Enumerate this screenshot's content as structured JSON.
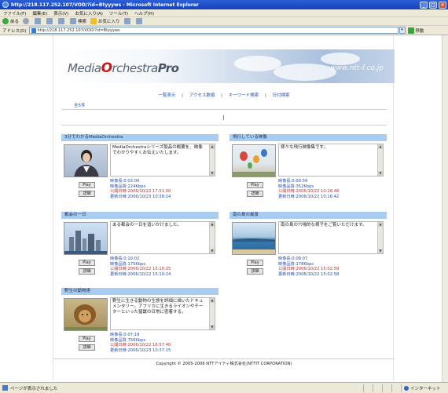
{
  "window": {
    "title": "http://218.117.252.107/VOD/?id=Btyyyws - Microsoft Internet Explorer",
    "min_label": "_",
    "max_label": "□",
    "close_label": "×"
  },
  "menu": [
    "ファイル(F)",
    "編集(E)",
    "表示(V)",
    "お気に入り(A)",
    "ツール(T)",
    "ヘルプ(H)"
  ],
  "toolbar": {
    "back_label": "戻る",
    "search_label": "検索",
    "favorites_label": "お気に入り"
  },
  "address": {
    "label": "アドレス(D)",
    "url": "http://218.117.252.107/VOD/?id=Btyyyws",
    "go_label": "移動"
  },
  "page": {
    "logo_main": "MediaOrchestra",
    "logo_pro": "Pro",
    "site_url": "www.ntt-f.co.jp",
    "nav": [
      "一覧表示",
      "アクセス数順",
      "キーワード検索",
      "日付検索"
    ],
    "nav_sep": "|",
    "count": "全5件",
    "footer": "Copyright © 2005-2006 NTTアイティ株式会社(NTTIT CORPORATION)"
  },
  "videos": [
    {
      "title": "3分でわかるMediaOrchestra",
      "description": "MediaOrchestraシリーズ製品の概要を、映像でわかりやすくお伝えいたします。",
      "play_label": "Play",
      "detail_label": "詳細",
      "duration": "映像長:0:03:00",
      "bitrate": "映像品質:224Kbps",
      "published": "公開日時:2006/10/22 17:51:00",
      "updated": "更新日時:2006/10/23 10:38:14"
    },
    {
      "title": "飛行している映像",
      "description": "様々な飛行映像集です。",
      "play_label": "Play",
      "detail_label": "詳細",
      "duration": "映像長:0:00:59",
      "bitrate": "映像品質:352Kbps",
      "published": "公開日時:2006/10/22 10:16:48",
      "updated": "更新日時:2006/10/22 10:16:42"
    },
    {
      "title": "都会の一日",
      "description": "ある都会の一日を追いかけました。",
      "play_label": "Play",
      "detail_label": "詳細",
      "duration": "映像長:0:10:02",
      "bitrate": "映像品質:175Kbps",
      "published": "公開日時:2006/10/22 15:10:25",
      "updated": "更新日時:2006/10/22 15:10:24"
    },
    {
      "title": "南の島の風景",
      "description": "南の島の穴場的な様子をご覧いただけます。",
      "play_label": "Play",
      "detail_label": "詳細",
      "duration": "映像長:0:08:07",
      "bitrate": "映像品質:178Kbps",
      "published": "公開日時:2006/10/22 15:02:59",
      "updated": "更新日時:2006/10/22 15:02:58"
    },
    {
      "title": "野生の動物達",
      "description": "野生に生きる動物の生態を詳細に描いたドキュメンタリー。アフリカに生きるライオンやチーターといった猛獣の日常に密着する。",
      "play_label": "Play",
      "detail_label": "詳細",
      "duration": "映像長:0:07:19",
      "bitrate": "映像品質:756Kbps",
      "published": "公開日時:2006/10/22 16:57:40",
      "updated": "更新日時:2006/10/23 10:37:15"
    }
  ],
  "status": {
    "text": "ページが表示されました",
    "zone": "インターネット"
  },
  "colors": {
    "card_header": "#a9cdf0",
    "link": "#2a4fa8",
    "titlebar": "#1f4fc8"
  }
}
